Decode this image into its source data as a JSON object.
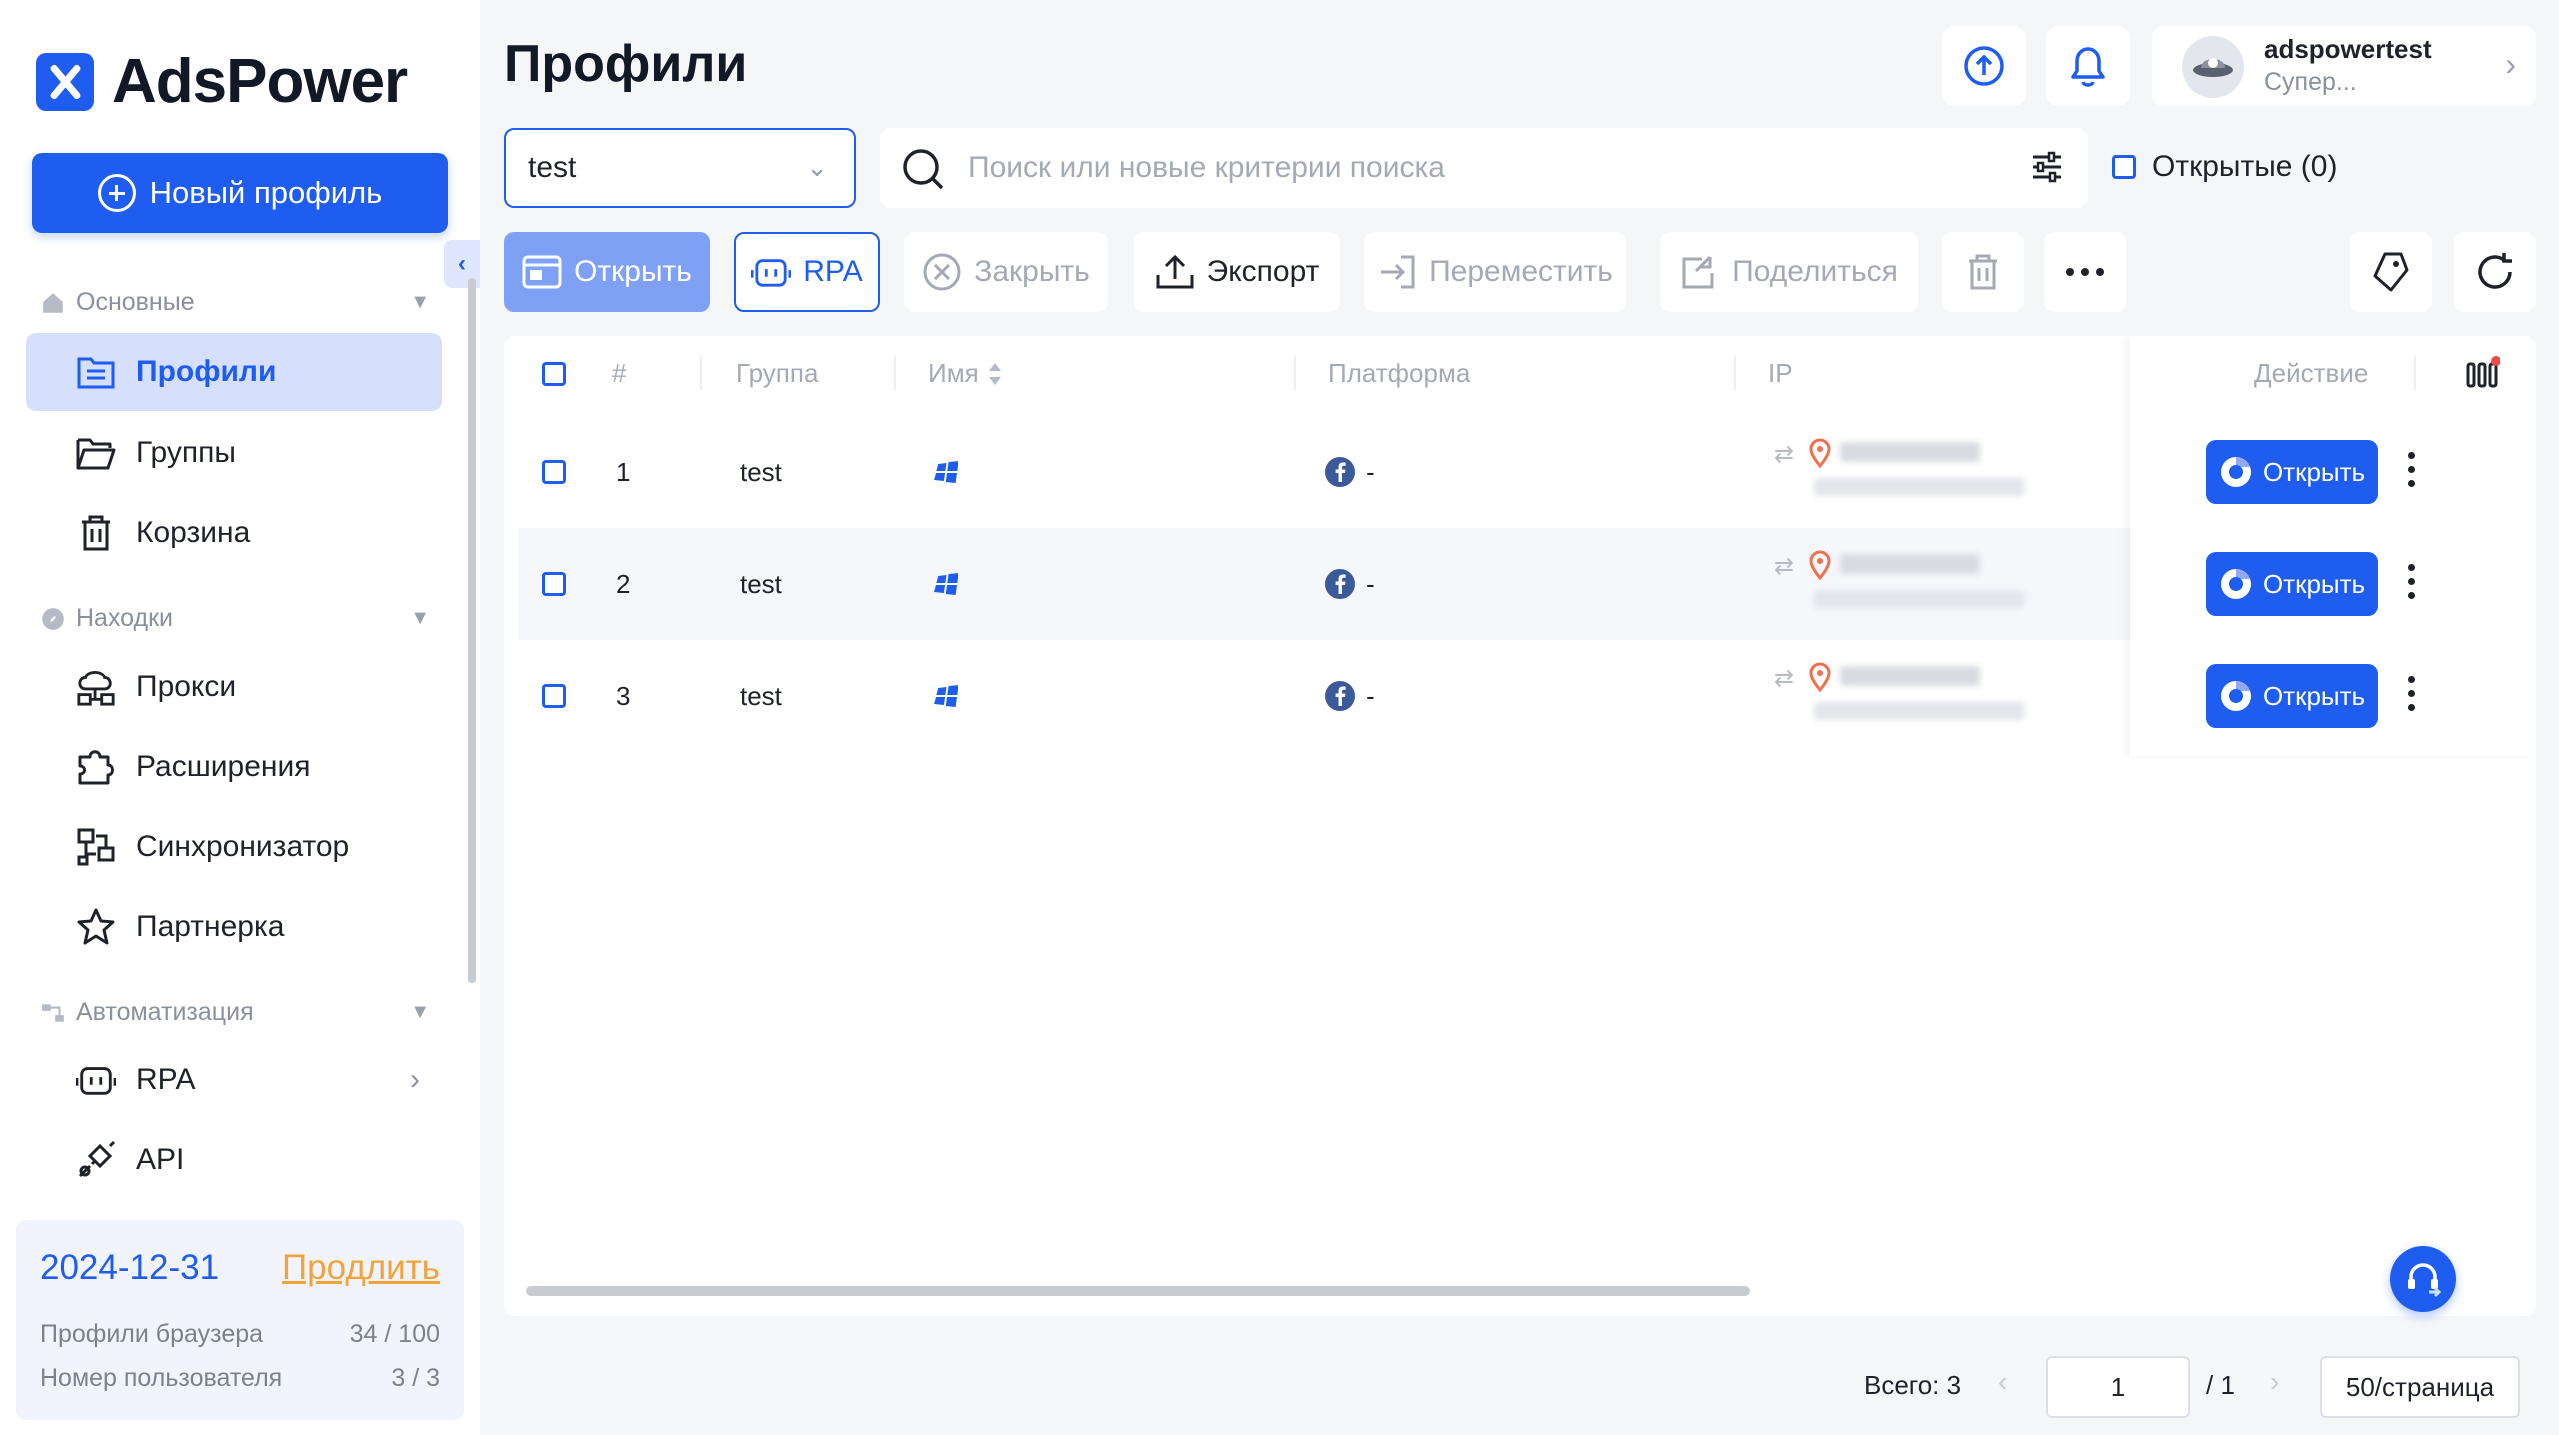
{
  "app": {
    "name": "AdsPower"
  },
  "sidebar": {
    "new_profile_label": "Новый профиль",
    "sections": [
      {
        "label": "Основные"
      },
      {
        "label": "Находки"
      },
      {
        "label": "Автоматизация"
      }
    ],
    "items": [
      {
        "label": "Профили",
        "icon": "profiles-icon",
        "active": true
      },
      {
        "label": "Группы",
        "icon": "folder-icon"
      },
      {
        "label": "Корзина",
        "icon": "trash-icon"
      },
      {
        "label": "Прокси",
        "icon": "proxy-icon"
      },
      {
        "label": "Расширения",
        "icon": "puzzle-icon"
      },
      {
        "label": "Синхронизатор",
        "icon": "sync-icon"
      },
      {
        "label": "Партнерка",
        "icon": "star-icon"
      },
      {
        "label": "RPA",
        "icon": "robot-icon"
      },
      {
        "label": "API",
        "icon": "plug-icon"
      }
    ],
    "license": {
      "date": "2024-12-31",
      "renew": "Продлить",
      "rows": [
        {
          "label": "Профили браузера",
          "value": "34 / 100"
        },
        {
          "label": "Номер пользователя",
          "value": "3 / 3"
        }
      ]
    }
  },
  "header": {
    "title": "Профили",
    "user": {
      "name": "adspowertest",
      "role": "Супер..."
    }
  },
  "filters": {
    "group_value": "test",
    "search_placeholder": "Поиск или новые критерии поиска",
    "opened_label": "Открытые (0)"
  },
  "toolbar": {
    "open": "Открыть",
    "rpa": "RPA",
    "close": "Закрыть",
    "export": "Экспорт",
    "move": "Переместить",
    "share": "Поделиться"
  },
  "table": {
    "columns": {
      "num": "#",
      "group": "Группа",
      "name": "Имя",
      "platform": "Платформа",
      "ip": "IP",
      "action": "Действие"
    },
    "rows": [
      {
        "num": "1",
        "group": "test",
        "platform_text": "-",
        "open_label": "Открыть"
      },
      {
        "num": "2",
        "group": "test",
        "platform_text": "-",
        "open_label": "Открыть"
      },
      {
        "num": "3",
        "group": "test",
        "platform_text": "-",
        "open_label": "Открыть"
      }
    ]
  },
  "pagination": {
    "total": "Всего: 3",
    "current_page": "1",
    "of_pages": "/ 1",
    "page_size": "50/страница"
  },
  "colors": {
    "accent": "#1f5cf0",
    "renew": "#f2a33a",
    "active_bg": "#d6e0fc"
  }
}
